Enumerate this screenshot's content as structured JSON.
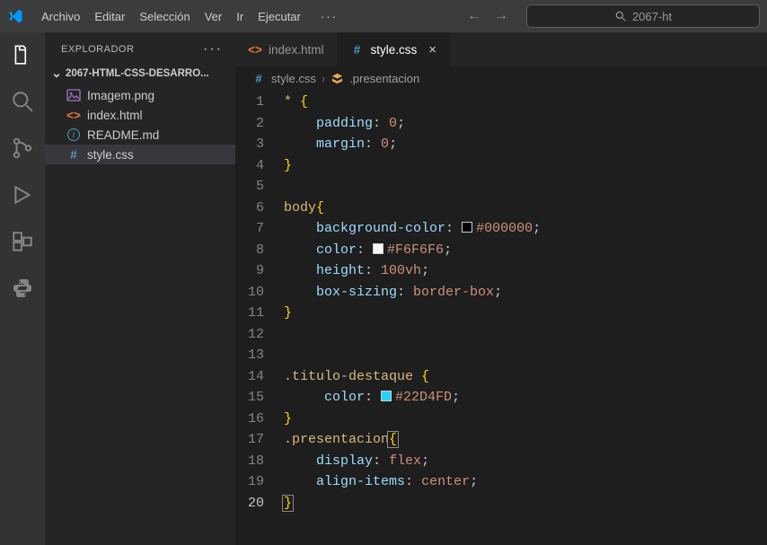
{
  "menu": {
    "items": [
      "Archivo",
      "Editar",
      "Selección",
      "Ver",
      "Ir",
      "Ejecutar"
    ]
  },
  "search": {
    "placeholder": "2067-ht"
  },
  "sidebar": {
    "title": "EXPLORADOR",
    "folder": "2067-HTML-CSS-DESARRO...",
    "files": [
      {
        "name": "Imagem.png",
        "icon": "image"
      },
      {
        "name": "index.html",
        "icon": "html"
      },
      {
        "name": "README.md",
        "icon": "info"
      },
      {
        "name": "style.css",
        "icon": "css"
      }
    ],
    "active_index": 3
  },
  "tabs": {
    "items": [
      {
        "label": "index.html",
        "icon": "html"
      },
      {
        "label": "style.css",
        "icon": "css"
      }
    ],
    "active_index": 1
  },
  "breadcrumb": {
    "file": "style.css",
    "symbol": ".presentacion"
  },
  "code": {
    "lines": [
      {
        "n": 1,
        "tokens": [
          [
            "sel",
            "* "
          ],
          [
            "brace",
            "{"
          ]
        ]
      },
      {
        "n": 2,
        "tokens": [
          [
            "indent",
            "    "
          ],
          [
            "prop",
            "padding"
          ],
          [
            "punc",
            ": "
          ],
          [
            "val",
            "0"
          ],
          [
            "punc",
            ";"
          ]
        ]
      },
      {
        "n": 3,
        "tokens": [
          [
            "indent",
            "    "
          ],
          [
            "prop",
            "margin"
          ],
          [
            "punc",
            ": "
          ],
          [
            "val",
            "0"
          ],
          [
            "punc",
            ";"
          ]
        ]
      },
      {
        "n": 4,
        "tokens": [
          [
            "brace",
            "}"
          ]
        ]
      },
      {
        "n": 5,
        "tokens": []
      },
      {
        "n": 6,
        "tokens": [
          [
            "sel",
            "body"
          ],
          [
            "brace",
            "{"
          ]
        ]
      },
      {
        "n": 7,
        "tokens": [
          [
            "indent",
            "    "
          ],
          [
            "prop",
            "background-color"
          ],
          [
            "punc",
            ": "
          ],
          [
            "swatch",
            "#000000"
          ],
          [
            "val",
            "#000000"
          ],
          [
            "punc",
            ";"
          ]
        ]
      },
      {
        "n": 8,
        "tokens": [
          [
            "indent",
            "    "
          ],
          [
            "prop",
            "color"
          ],
          [
            "punc",
            ": "
          ],
          [
            "swatch",
            "#F6F6F6"
          ],
          [
            "val",
            "#F6F6F6"
          ],
          [
            "punc",
            ";"
          ]
        ]
      },
      {
        "n": 9,
        "tokens": [
          [
            "indent",
            "    "
          ],
          [
            "prop",
            "height"
          ],
          [
            "punc",
            ": "
          ],
          [
            "val",
            "100vh"
          ],
          [
            "punc",
            ";"
          ]
        ]
      },
      {
        "n": 10,
        "tokens": [
          [
            "indent",
            "    "
          ],
          [
            "prop",
            "box-sizing"
          ],
          [
            "punc",
            ": "
          ],
          [
            "val",
            "border-box"
          ],
          [
            "punc",
            ";"
          ]
        ]
      },
      {
        "n": 11,
        "tokens": [
          [
            "brace",
            "}"
          ]
        ]
      },
      {
        "n": 12,
        "tokens": []
      },
      {
        "n": 13,
        "tokens": []
      },
      {
        "n": 14,
        "tokens": [
          [
            "sel",
            ".titulo-destaque "
          ],
          [
            "brace",
            "{"
          ]
        ]
      },
      {
        "n": 15,
        "tokens": [
          [
            "indent",
            "     "
          ],
          [
            "prop",
            "color"
          ],
          [
            "punc",
            ": "
          ],
          [
            "swatch",
            "#22D4FD"
          ],
          [
            "val",
            "#22D4FD"
          ],
          [
            "punc",
            ";"
          ]
        ]
      },
      {
        "n": 16,
        "tokens": [
          [
            "brace",
            "}"
          ]
        ]
      },
      {
        "n": 17,
        "tokens": [
          [
            "sel",
            ".presentacion"
          ],
          [
            "hbrace",
            "{"
          ]
        ]
      },
      {
        "n": 18,
        "tokens": [
          [
            "indent",
            "    "
          ],
          [
            "prop",
            "display"
          ],
          [
            "punc",
            ": "
          ],
          [
            "val",
            "flex"
          ],
          [
            "punc",
            ";"
          ]
        ]
      },
      {
        "n": 19,
        "tokens": [
          [
            "indent",
            "    "
          ],
          [
            "prop",
            "align-items"
          ],
          [
            "punc",
            ": "
          ],
          [
            "val",
            "center"
          ],
          [
            "punc",
            ";"
          ]
        ]
      },
      {
        "n": 20,
        "tokens": [
          [
            "hbrace",
            "}"
          ]
        ]
      }
    ],
    "current_line": 20
  }
}
